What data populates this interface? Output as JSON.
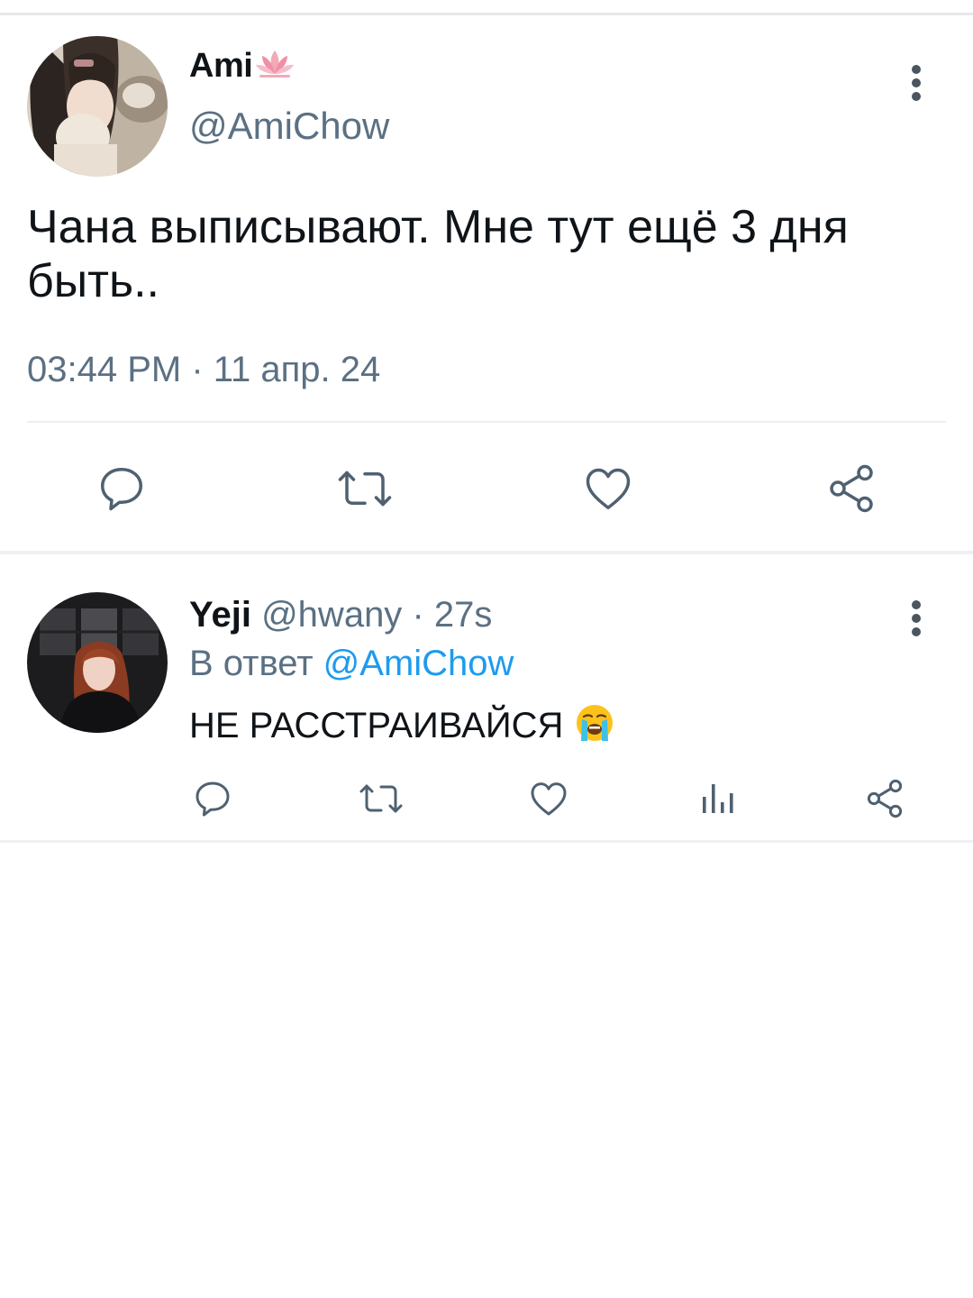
{
  "tweet": {
    "author": {
      "display_name": "Ami",
      "display_emoji": "lotus-emoji",
      "handle": "@AmiChow"
    },
    "text": "Чана выписывают. Мне тут ещё 3 дня быть..",
    "timestamp": "03:44 PM · 11 апр. 24",
    "actions": [
      "reply-icon",
      "retweet-icon",
      "like-icon",
      "share-icon"
    ]
  },
  "reply": {
    "author": {
      "display_name": "Yeji",
      "handle": "@hwany",
      "time": "· 27s"
    },
    "reply_prefix": "В ответ",
    "reply_to": "@AmiChow",
    "text": "НЕ РАССТРАИВАЙСЯ",
    "text_emoji": "loudly-crying-face-emoji",
    "actions": [
      "reply-icon",
      "retweet-icon",
      "like-icon",
      "views-icon",
      "share-icon"
    ]
  },
  "colors": {
    "text_primary": "#0f1419",
    "text_secondary": "#5b7083",
    "accent": "#1d9bf0",
    "icon": "#4f6171",
    "divider": "#eceff1"
  }
}
